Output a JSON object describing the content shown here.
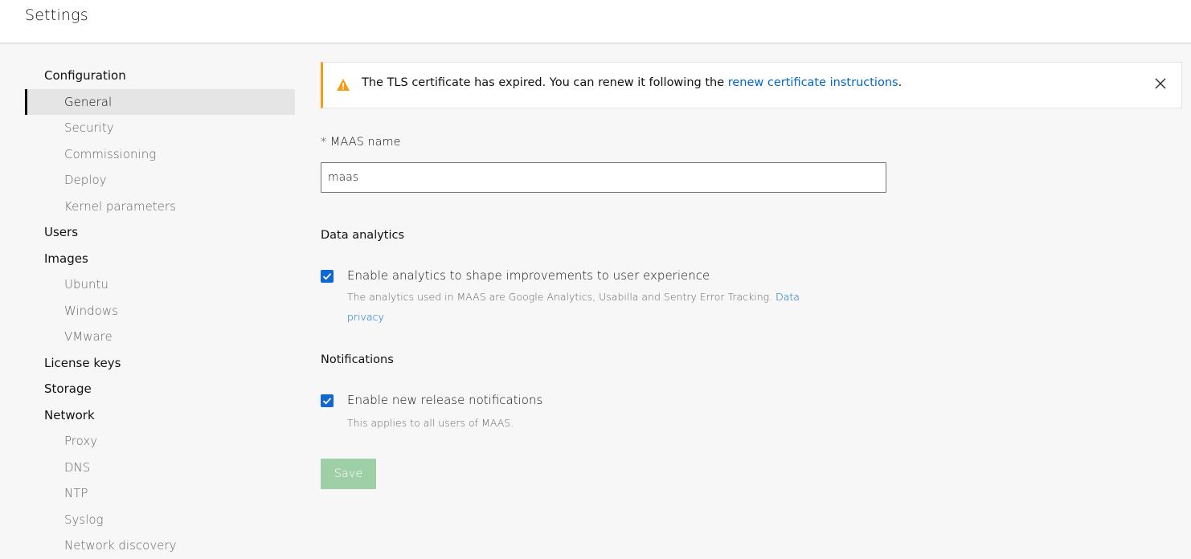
{
  "header": {
    "title": "Settings"
  },
  "sidebar": {
    "items": [
      {
        "label": "Configuration",
        "level": "section",
        "active": false
      },
      {
        "label": "General",
        "level": "sub",
        "active": true
      },
      {
        "label": "Security",
        "level": "sub",
        "active": false
      },
      {
        "label": "Commissioning",
        "level": "sub",
        "active": false
      },
      {
        "label": "Deploy",
        "level": "sub",
        "active": false
      },
      {
        "label": "Kernel parameters",
        "level": "sub",
        "active": false
      },
      {
        "label": "Users",
        "level": "section",
        "active": false
      },
      {
        "label": "Images",
        "level": "section",
        "active": false
      },
      {
        "label": "Ubuntu",
        "level": "sub",
        "active": false
      },
      {
        "label": "Windows",
        "level": "sub",
        "active": false
      },
      {
        "label": "VMware",
        "level": "sub",
        "active": false
      },
      {
        "label": "License keys",
        "level": "section",
        "active": false
      },
      {
        "label": "Storage",
        "level": "section",
        "active": false
      },
      {
        "label": "Network",
        "level": "section",
        "active": false
      },
      {
        "label": "Proxy",
        "level": "sub",
        "active": false
      },
      {
        "label": "DNS",
        "level": "sub",
        "active": false
      },
      {
        "label": "NTP",
        "level": "sub",
        "active": false
      },
      {
        "label": "Syslog",
        "level": "sub",
        "active": false
      },
      {
        "label": "Network discovery",
        "level": "sub",
        "active": false
      }
    ]
  },
  "notification": {
    "text": "The TLS certificate has expired. You can renew it following the ",
    "link_text": "renew certificate instructions",
    "suffix": ".",
    "icon": "warning-icon",
    "accent_color": "#f99b11"
  },
  "form": {
    "maas_name_label": "* MAAS name",
    "maas_name_value": "maas",
    "analytics_heading": "Data analytics",
    "analytics_checkbox_label": "Enable analytics to shape improvements to user experience",
    "analytics_checked": true,
    "analytics_help": "The analytics used in MAAS are Google Analytics, Usabilla and Sentry Error Tracking. ",
    "analytics_help_link": "Data privacy",
    "notifications_heading": "Notifications",
    "notifications_checkbox_label": "Enable new release notifications",
    "notifications_checked": true,
    "notifications_help": "This applies to all users of MAAS.",
    "save_label": "Save"
  },
  "colors": {
    "link": "#0066cc",
    "checkbox": "#0e67d3",
    "save_disabled": "#9fcfa7"
  }
}
